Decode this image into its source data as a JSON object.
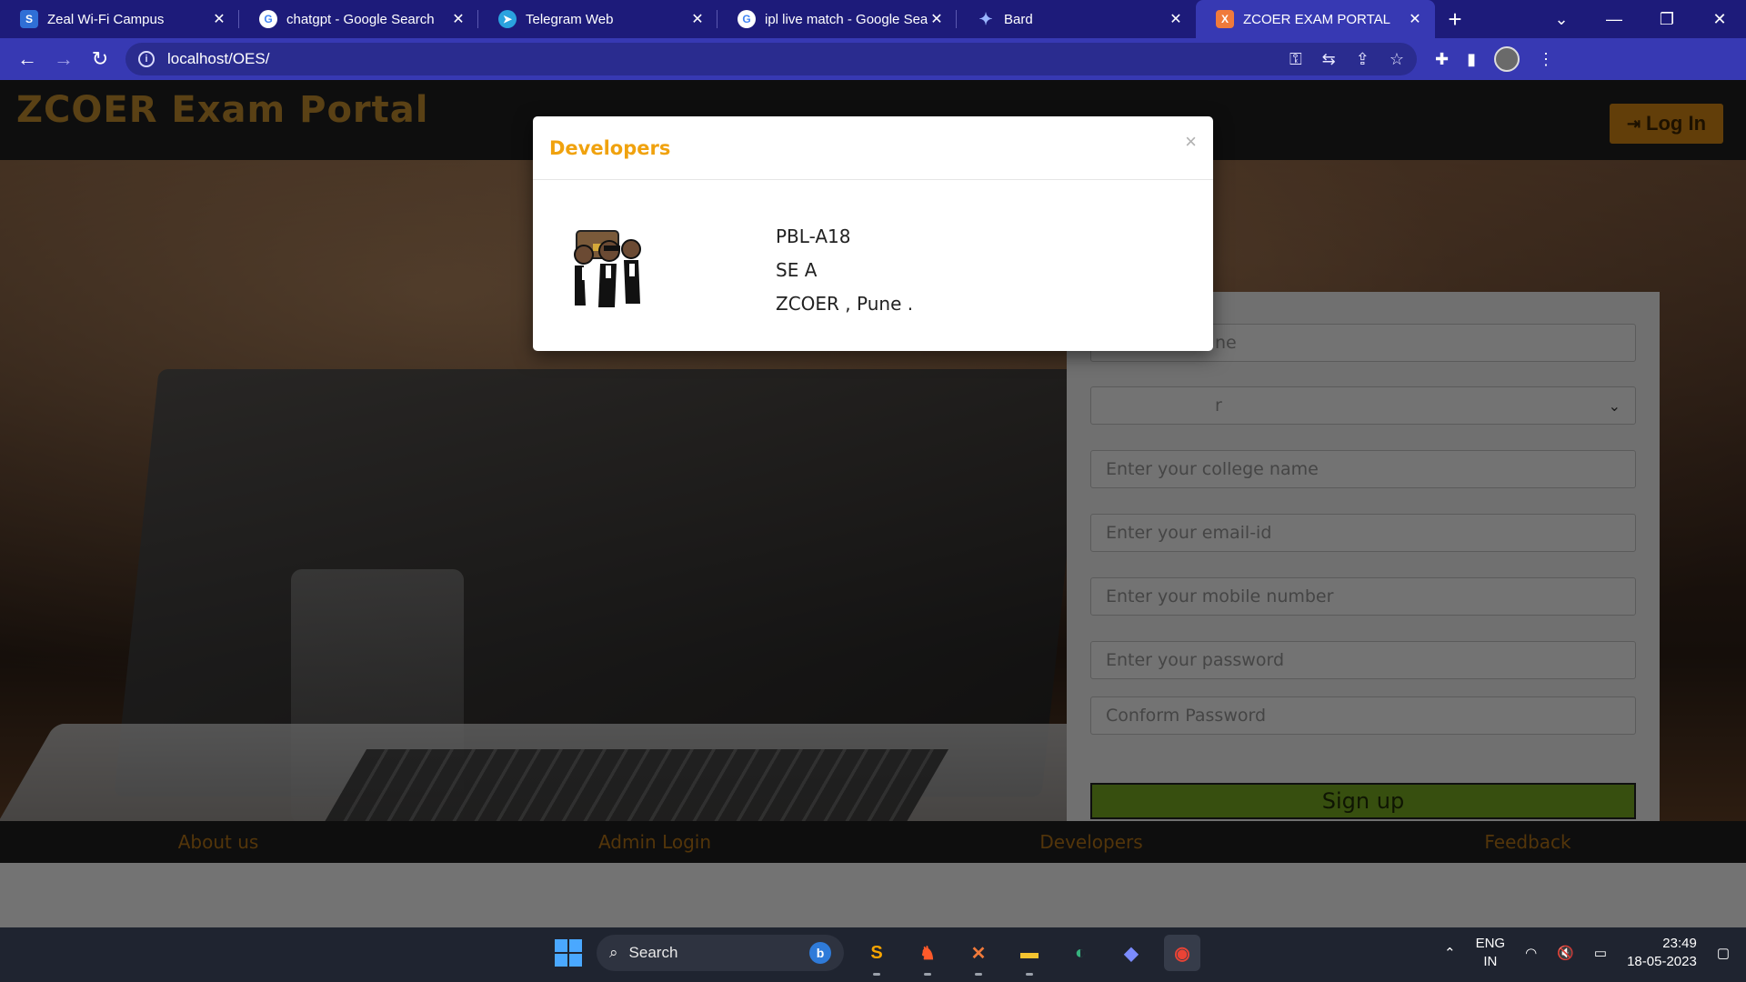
{
  "browser": {
    "tabs": [
      {
        "title": "Zeal Wi-Fi Campus",
        "favicon": "S",
        "icon": "zeal-favicon"
      },
      {
        "title": "chatgpt - Google Search",
        "favicon": "G",
        "icon": "google-favicon"
      },
      {
        "title": "Telegram Web",
        "favicon": "➤",
        "icon": "telegram-favicon"
      },
      {
        "title": "ipl live match - Google Sear",
        "favicon": "G",
        "icon": "google-favicon"
      },
      {
        "title": "Bard",
        "favicon": "✦",
        "icon": "bard-favicon"
      },
      {
        "title": "ZCOER EXAM PORTAL",
        "favicon": "X",
        "icon": "xampp-favicon",
        "active": true
      }
    ],
    "close_glyph": "✕",
    "new_tab_glyph": "+",
    "url": "localhost/OES/"
  },
  "site": {
    "title": "ZCOER Exam Portal",
    "login_label": "Log In",
    "colors": {
      "title": "#b5832a",
      "login_button": "#c47d12",
      "signup_button": "#6e9e1e",
      "footer_link": "#a66b14"
    }
  },
  "signup_form": {
    "name_placeholder": "ne",
    "gender_placeholder": "r",
    "college_placeholder": "Enter your college name",
    "email_placeholder": "Enter your email-id",
    "mobile_placeholder": "Enter your mobile number",
    "password_placeholder": "Enter your password",
    "confirm_placeholder": "Conform Password",
    "signup_label": "Sign up"
  },
  "footer": {
    "links": [
      "About us",
      "Admin Login",
      "Developers",
      "Feedback"
    ]
  },
  "modal": {
    "title": "Developers",
    "close_glyph": "×",
    "lines": [
      "PBL-A18",
      "SE A",
      "ZCOER , Pune ."
    ],
    "title_color": "#f0a20e"
  },
  "taskbar": {
    "search_label": "Search",
    "lang_top": "ENG",
    "lang_bottom": "IN",
    "time": "23:49",
    "date": "18-05-2023"
  }
}
